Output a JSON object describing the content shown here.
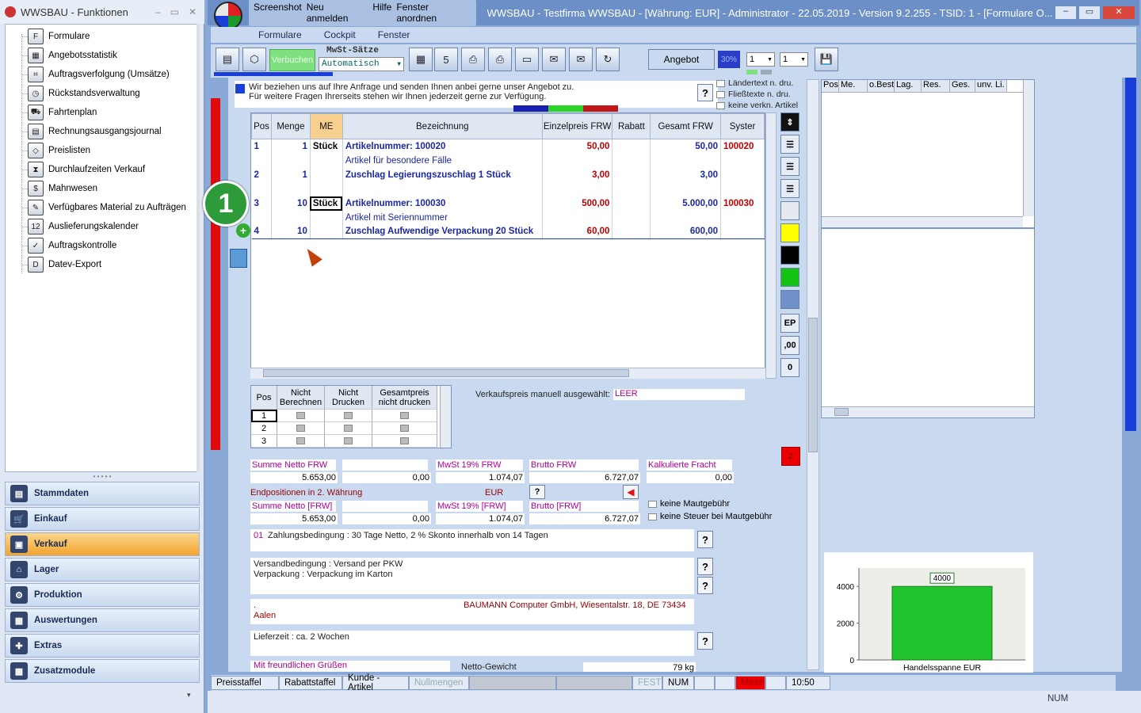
{
  "left": {
    "title": "WWSBAU - Funktionen",
    "tree": [
      "Formulare",
      "Angebotsstatistik",
      "Auftragsverfolgung (Umsätze)",
      "Rückstandsverwaltung",
      "Fahrtenplan",
      "Rechnungsausgangsjournal",
      "Preislisten",
      "Durchlaufzeiten Verkauf",
      "Mahnwesen",
      "Verfügbares Material zu Aufträgen",
      "Auslieferungskalender",
      "Auftragskontrolle",
      "Datev-Export"
    ],
    "nav": [
      "Stammdaten",
      "Einkauf",
      "Verkauf",
      "Lager",
      "Produktion",
      "Auswertungen",
      "Extras",
      "Zusatzmodule"
    ]
  },
  "main": {
    "title": "WWSBAU - Testfirma WWSBAU - [Währung: EUR] - Administrator - 22.05.2019 - Version 9.2.255 - TSID: 1 - [Formulare O...",
    "topmenu": [
      "Screenshot",
      "Neu anmelden",
      "Hilfe",
      "Fenster anordnen"
    ],
    "menu": [
      "Formulare",
      "Cockpit",
      "Fenster"
    ],
    "toolbar": {
      "verbuchen": "Verbuchen",
      "mwst_label": "MwSt-Sätze",
      "mwst_value": "Automatisch",
      "angebot": "Angebot",
      "percent": "30%",
      "sel1": "1",
      "sel2": "1"
    },
    "intro": [
      "Wir beziehen uns auf Ihre Anfrage und senden Ihnen anbei gerne unser Angebot zu.",
      "Für weitere Fragen Ihrerseits stehen wir Ihnen jederzeit gerne zur Verfügung."
    ],
    "options": [
      "Ländertext n. dru.",
      "Fließtexte n. dru.",
      "keine verkn. Artikel"
    ],
    "grid": {
      "headers": [
        "Pos",
        "Menge",
        "ME",
        "Bezeichnung",
        "Einzelpreis FRW",
        "Rabatt",
        "Gesamt FRW",
        "Syster"
      ],
      "rows": [
        {
          "pos": "1",
          "menge": "1",
          "me": "Stück",
          "bez": "Artikelnummer: 100020",
          "ep": "50,00",
          "rabatt": "",
          "gesamt": "50,00",
          "sys": "100020"
        },
        {
          "pos": "",
          "menge": "",
          "me": "",
          "bez": "Artikel für besondere Fälle",
          "ep": "",
          "rabatt": "",
          "gesamt": "",
          "sys": ""
        },
        {
          "pos": "2",
          "menge": "1",
          "me": "",
          "bez": "Zuschlag Legierungszuschlag 1 Stück",
          "ep": "3,00",
          "rabatt": "",
          "gesamt": "3,00",
          "sys": ""
        },
        {
          "pos": "",
          "menge": "",
          "me": "",
          "bez": "",
          "ep": "",
          "rabatt": "",
          "gesamt": "",
          "sys": ""
        },
        {
          "pos": "3",
          "menge": "10",
          "me": "Stück",
          "bez": "Artikelnummer: 100030",
          "ep": "500,00",
          "rabatt": "",
          "gesamt": "5.000,00",
          "sys": "100030"
        },
        {
          "pos": "",
          "menge": "",
          "me": "",
          "bez": "Artikel mit Seriennummer",
          "ep": "",
          "rabatt": "",
          "gesamt": "",
          "sys": ""
        },
        {
          "pos": "4",
          "menge": "10",
          "me": "",
          "bez": "Zuschlag Aufwendige Verpackung 20 Stück",
          "ep": "60,00",
          "rabatt": "",
          "gesamt": "600,00",
          "sys": ""
        }
      ]
    },
    "marker": "1",
    "sidebtn": {
      "ep": "EP",
      "dec": ",00",
      "zero": "0"
    },
    "small": {
      "headers": [
        "Pos",
        "Nicht Berechnen",
        "Nicht Drucken",
        "Gesamtpreis nicht drucken"
      ],
      "rows": [
        "1",
        "2",
        "3"
      ]
    },
    "vk_label": "Verkaufspreis manuell ausgewählt:",
    "vk_value": "LEER",
    "sums": {
      "l1": "Summe Netto FRW",
      "v1": "5.653,00",
      "v2": "0,00",
      "l3": "MwSt 19% FRW",
      "v3": "1.074,07",
      "l4": "Brutto FRW",
      "v4": "6.727,07",
      "l5": "Kalkulierte Fracht",
      "v5": "0,00",
      "end_label": "Endpositionen in 2. Währung",
      "cur": "EUR",
      "l6": "Summe Netto [FRW]",
      "v6": "5.653,00",
      "v7": "0,00",
      "l8": "MwSt 19% [FRW]",
      "v8": "1.074,07",
      "l9": "Brutto [FRW]",
      "v9": "6.727,07",
      "cb1": "keine Mautgebühr",
      "cb2": "keine Steuer bei Mautgebühr"
    },
    "zahl_code": "01",
    "zahl": "Zahlungsbedingung : 30 Tage Netto, 2 % Skonto innerhalb von 14 Tagen",
    "versand1": "Versandbedingung : Versand per PKW",
    "versand2": "Verpackung : Verpackung im Karton",
    "addr_prefix": ".",
    "addr": "BAUMANN Computer GmbH, Wiesentalstr. 18, DE 73434",
    "addr2": "Aalen",
    "lieferzeit": "Lieferzeit : ca. 2 Wochen",
    "gruss": "Mit freundlichen Grüßen",
    "netto_gewicht_label": "Netto-Gewicht",
    "netto_gewicht": "79 kg",
    "rightgrid": [
      "Pos",
      "Me.",
      "o.Best",
      "Lag.",
      "Res.",
      "Ges.",
      "unv. Li."
    ],
    "status": [
      "Preisstaffel",
      "Rabattstaffel",
      "Kunde - Artikel",
      "Nullmengen",
      "",
      "",
      "FEST",
      "NUM",
      "",
      "",
      "Miete",
      "",
      "10:50"
    ],
    "bottom_num": "NUM"
  },
  "chart_data": {
    "type": "bar",
    "categories": [
      "Handelsspanne EUR"
    ],
    "values": [
      4000
    ],
    "ylim": [
      0,
      5000
    ],
    "yticks": [
      0,
      2000,
      4000
    ],
    "data_label": "4000",
    "color": "#22c42f"
  }
}
